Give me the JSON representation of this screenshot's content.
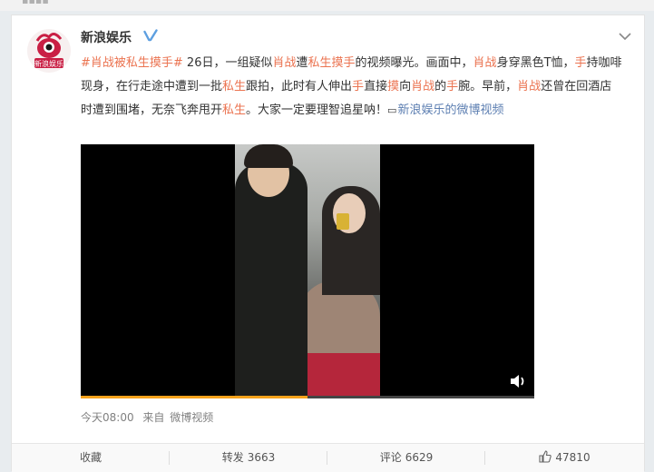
{
  "author": {
    "name": "新浪娱乐",
    "verified": true,
    "avatar_text": "新浪娱乐"
  },
  "post": {
    "segments": [
      {
        "text": "#肖战被私生摸手#",
        "style": "tag"
      },
      {
        "text": " 26日，一组疑似",
        "style": "plain"
      },
      {
        "text": "肖战",
        "style": "hl"
      },
      {
        "text": "遭",
        "style": "plain"
      },
      {
        "text": "私生摸手",
        "style": "hl"
      },
      {
        "text": "的视频曝光。画面中，",
        "style": "plain"
      },
      {
        "text": "肖战",
        "style": "hl"
      },
      {
        "text": "身穿黑色T恤，",
        "style": "plain"
      },
      {
        "text": "手",
        "style": "hl"
      },
      {
        "text": "持咖啡现身，在行走途中遭到一批",
        "style": "plain"
      },
      {
        "text": "私生",
        "style": "hl"
      },
      {
        "text": "跟拍，此时有人伸出",
        "style": "plain"
      },
      {
        "text": "手",
        "style": "hl"
      },
      {
        "text": "直接",
        "style": "plain"
      },
      {
        "text": "摸",
        "style": "hl"
      },
      {
        "text": "向",
        "style": "plain"
      },
      {
        "text": "肖战",
        "style": "hl"
      },
      {
        "text": "的",
        "style": "plain"
      },
      {
        "text": "手",
        "style": "hl"
      },
      {
        "text": "腕。早前，",
        "style": "plain"
      },
      {
        "text": "肖战",
        "style": "hl"
      },
      {
        "text": "还曾在回酒店时遭到围堵，无奈飞奔甩开",
        "style": "plain"
      },
      {
        "text": "私生",
        "style": "hl"
      },
      {
        "text": "。大家一定要理智追星呐！",
        "style": "plain"
      },
      {
        "text": "新浪娱乐的微博视频",
        "style": "link"
      }
    ]
  },
  "video": {
    "progress": 0.5,
    "muted_icon": "volume-icon"
  },
  "meta": {
    "time": "今天08:00",
    "source_prefix": "来自",
    "source": "微博视频"
  },
  "actions": {
    "favorite_label": "收藏",
    "repost_label": "转发",
    "repost_count": "3663",
    "comment_label": "评论",
    "comment_count": "6629",
    "like_count": "47810"
  },
  "colors": {
    "accent": "#eb7350",
    "link": "#5d7fb2",
    "verified": "#f2a71b"
  }
}
